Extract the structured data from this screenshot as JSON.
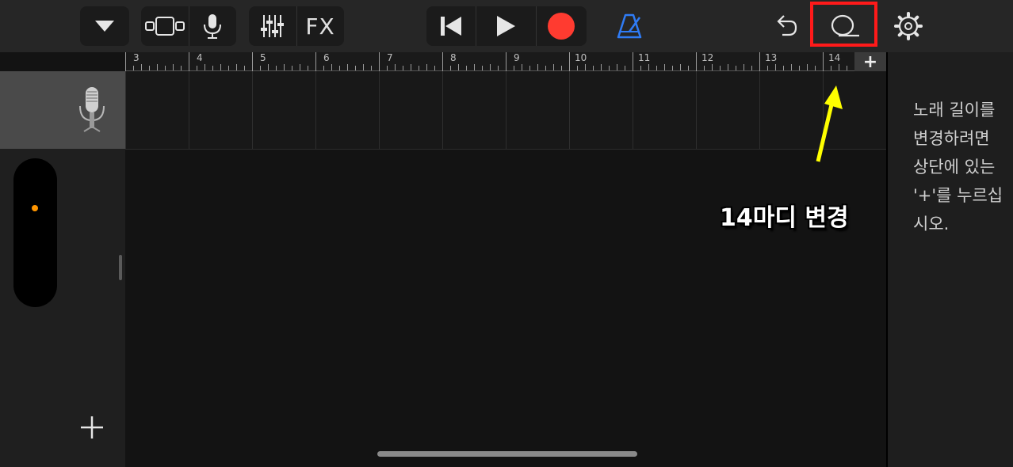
{
  "toolbar": {
    "fx_label": "FX",
    "icons": [
      "tracks-dropdown-icon",
      "view-toggle-icon",
      "microphone-icon",
      "mixer-sliders-icon",
      "skip-back-icon",
      "play-icon",
      "record-icon",
      "metronome-icon",
      "undo-icon",
      "loop-icon",
      "settings-gear-icon"
    ]
  },
  "colors": {
    "record": "#ff3b30",
    "metronome": "#2f7cf6",
    "highlight": "#ff1a1a",
    "arrow": "#ffff00",
    "region_dot": "#ff9500"
  },
  "ruler": {
    "bars": [
      "3",
      "4",
      "5",
      "6",
      "7",
      "8",
      "9",
      "10",
      "11",
      "12",
      "13",
      "14"
    ],
    "add_label": "+"
  },
  "sidebar": {
    "track_instrument": "condenser-microphone",
    "add_track_label": "+"
  },
  "notes": {
    "text": "노래 길이를 변경하려면 상단에 있는 '+'를 누르십시오."
  },
  "annotation": {
    "label": "14마디 변경"
  }
}
